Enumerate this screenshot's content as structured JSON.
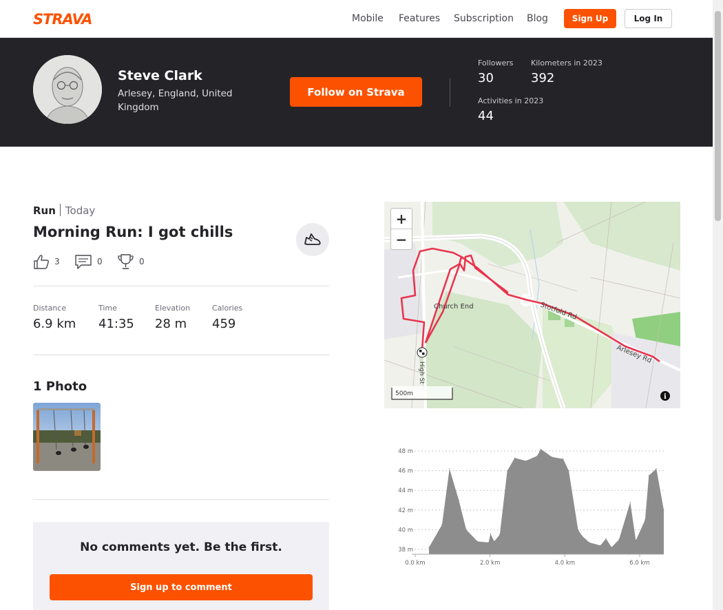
{
  "nav": {
    "logo_text": "STRAVA",
    "links": [
      "Mobile",
      "Features",
      "Subscription",
      "Blog"
    ],
    "signup_label": "Sign Up",
    "login_label": "Log In"
  },
  "athlete": {
    "name": "Steve Clark",
    "location": "Arlesey, England, United Kingdom",
    "follow_label": "Follow on Strava",
    "stats": {
      "followers_label": "Followers",
      "followers_value": "30",
      "km_label": "Kilometers in 2023",
      "km_value": "392",
      "activities_label": "Activities in 2023",
      "activities_value": "44"
    }
  },
  "activity": {
    "type": "Run",
    "date": "Today",
    "title": "Morning Run: I got chills",
    "kudos": "3",
    "comments": "0",
    "achievements": "0",
    "metrics": [
      {
        "label": "Distance",
        "value": "6.9 km"
      },
      {
        "label": "Time",
        "value": "41:35"
      },
      {
        "label": "Elevation",
        "value": "28 m"
      },
      {
        "label": "Calories",
        "value": "459"
      }
    ],
    "photos_title": "1 Photo"
  },
  "comments": {
    "empty_message": "No comments yet. Be the first.",
    "signup_label": "Sign up to comment"
  },
  "map": {
    "zoom_in": "+",
    "zoom_out": "−",
    "scale_label": "500m",
    "place_label": "Church End",
    "road_labels": [
      "Stotfold Rd",
      "Arlesey Rd",
      "High St"
    ],
    "route_color": "#e8354f"
  },
  "elevation_chart": {
    "y_ticks": [
      "38 m",
      "40 m",
      "42 m",
      "44 m",
      "46 m",
      "48 m"
    ],
    "x_ticks": [
      "0.0 km",
      "2.0 km",
      "4.0 km",
      "6.0 km"
    ]
  },
  "chart_data": {
    "type": "area",
    "title": "",
    "xlabel": "",
    "ylabel": "",
    "xlim": [
      0,
      6.3
    ],
    "ylim": [
      37.5,
      48.5
    ],
    "x": [
      0.0,
      0.35,
      0.55,
      0.8,
      1.0,
      1.3,
      1.6,
      1.65,
      1.75,
      1.9,
      2.1,
      2.3,
      2.6,
      2.9,
      3.0,
      3.3,
      3.6,
      3.75,
      4.0,
      4.1,
      4.3,
      4.6,
      4.75,
      4.9,
      5.1,
      5.4,
      5.55,
      5.8,
      5.9,
      6.1,
      6.3
    ],
    "values": [
      38.2,
      40.5,
      46.2,
      43.0,
      40.0,
      38.8,
      38.7,
      39.6,
      38.8,
      39.5,
      46.0,
      47.3,
      47.0,
      47.5,
      48.2,
      47.4,
      47.2,
      46.0,
      40.0,
      39.4,
      38.7,
      38.4,
      39.1,
      38.2,
      39.0,
      42.8,
      38.9,
      41.0,
      45.5,
      46.2,
      42.0
    ],
    "area_color": "#8d8d8d"
  }
}
